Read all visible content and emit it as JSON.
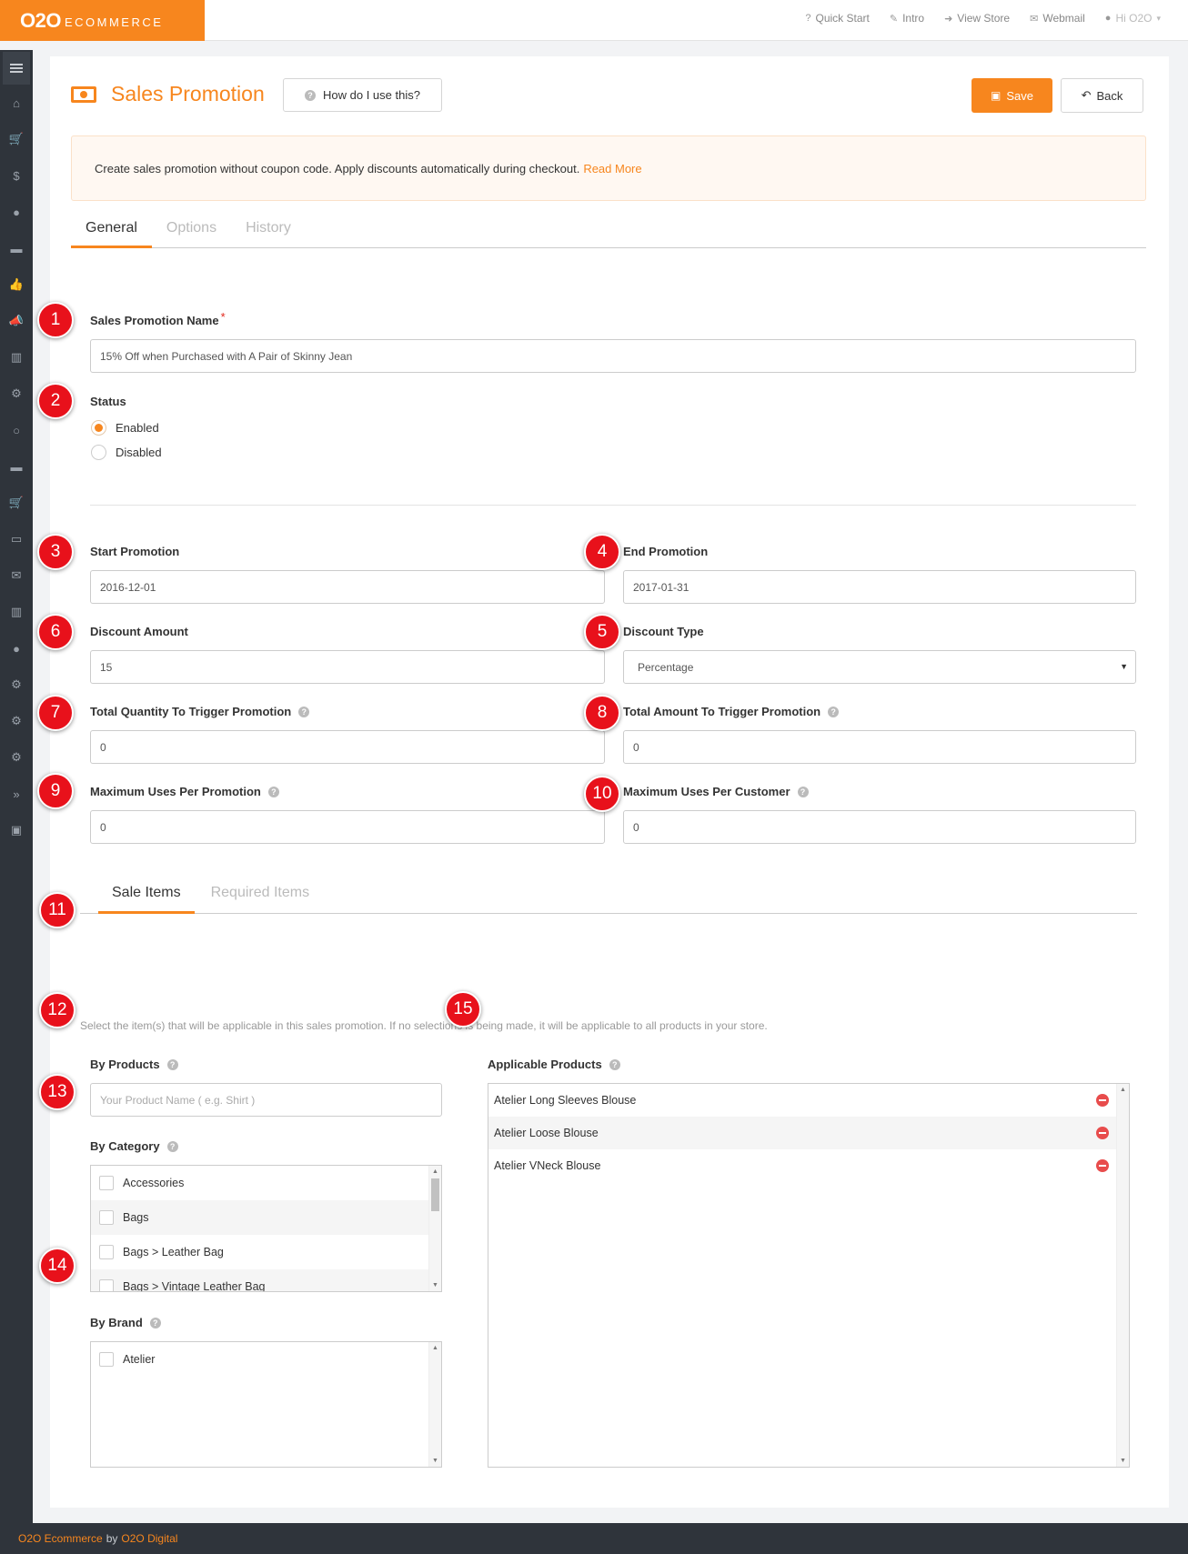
{
  "app": {
    "logo_mark": "O2O",
    "logo_word": "ECOMMERCE"
  },
  "topnav": {
    "items": [
      {
        "icon": "question-icon",
        "glyph": "?",
        "label": "Quick Start"
      },
      {
        "icon": "wand-icon",
        "glyph": "✎",
        "label": "Intro"
      },
      {
        "icon": "sign-in-icon",
        "glyph": "➜",
        "label": "View Store"
      },
      {
        "icon": "envelope-icon",
        "glyph": "✉",
        "label": "Webmail"
      }
    ],
    "user_label": "Hi O2O"
  },
  "sidebar": {
    "icons": [
      "menu-icon",
      "home-icon",
      "cart-icon",
      "dollar-icon",
      "user-icon",
      "book-icon",
      "thumbs-up-icon",
      "megaphone-icon",
      "bar-chart-icon",
      "cogs-icon",
      "comment-icon",
      "book-icon",
      "cart-icon",
      "money-icon",
      "envelope-icon",
      "bar-chart-icon",
      "globe-icon",
      "gear-icon",
      "gear-icon",
      "cogs-icon",
      "forward-icon",
      "image-icon"
    ],
    "glyphs": [
      "",
      "⌂",
      "🛒",
      "$",
      "●",
      "▬",
      "👍",
      "📣",
      "▥",
      "⚙",
      "○",
      "▬",
      "🛒",
      "▭",
      "✉",
      "▥",
      "●",
      "⚙",
      "⚙",
      "⚙",
      "»",
      "▣"
    ]
  },
  "header": {
    "title": "Sales Promotion",
    "help_label": "How do I use this?",
    "save_label": "Save",
    "back_label": "Back"
  },
  "info": {
    "text": "Create sales promotion without coupon code. Apply discounts automatically during checkout.",
    "link": "Read More"
  },
  "tabs": [
    "General",
    "Options",
    "History"
  ],
  "form": {
    "name_label": "Sales Promotion Name",
    "name_required": "*",
    "name_value": "15% Off when Purchased with A Pair of Skinny Jean",
    "status_label": "Status",
    "status_options": [
      "Enabled",
      "Disabled"
    ],
    "status_selected": "Enabled",
    "start_label": "Start Promotion",
    "start_value": "2016-12-01",
    "end_label": "End Promotion",
    "end_value": "2017-01-31",
    "discount_amount_label": "Discount Amount",
    "discount_amount_value": "15",
    "discount_type_label": "Discount Type",
    "discount_type_value": "Percentage",
    "total_qty_label": "Total Quantity To Trigger Promotion",
    "total_qty_value": "0",
    "total_amount_label": "Total Amount To Trigger Promotion",
    "total_amount_value": "0",
    "max_uses_promo_label": "Maximum Uses Per Promotion",
    "max_uses_promo_value": "0",
    "max_uses_customer_label": "Maximum Uses Per Customer",
    "max_uses_customer_value": "0"
  },
  "sale_tabs": [
    "Sale Items",
    "Required Items"
  ],
  "sale": {
    "hint": "Select the item(s) that will be applicable in this sales promotion. If no selections is being made, it will be applicable to all products in your store.",
    "by_products_label": "By Products",
    "by_products_placeholder": "Your Product Name ( e.g. Shirt )",
    "by_category_label": "By Category",
    "categories": [
      "Accessories",
      "Bags",
      "Bags > Leather Bag",
      "Bags > Vintage Leather Bag"
    ],
    "by_brand_label": "By Brand",
    "brands": [
      "Atelier"
    ],
    "applicable_label": "Applicable Products",
    "applicable_products": [
      "Atelier Long Sleeves Blouse",
      "Atelier Loose Blouse",
      "Atelier VNeck Blouse"
    ]
  },
  "badges": [
    "1",
    "2",
    "3",
    "4",
    "5",
    "6",
    "7",
    "8",
    "9",
    "10",
    "11",
    "12",
    "13",
    "14",
    "15"
  ],
  "footer": {
    "brand": "O2O Ecommerce",
    "by": "by",
    "company": "O2O Digital"
  },
  "colors": {
    "accent": "#f7861e",
    "badge": "#e8111b",
    "sidebar": "#2f343b"
  }
}
